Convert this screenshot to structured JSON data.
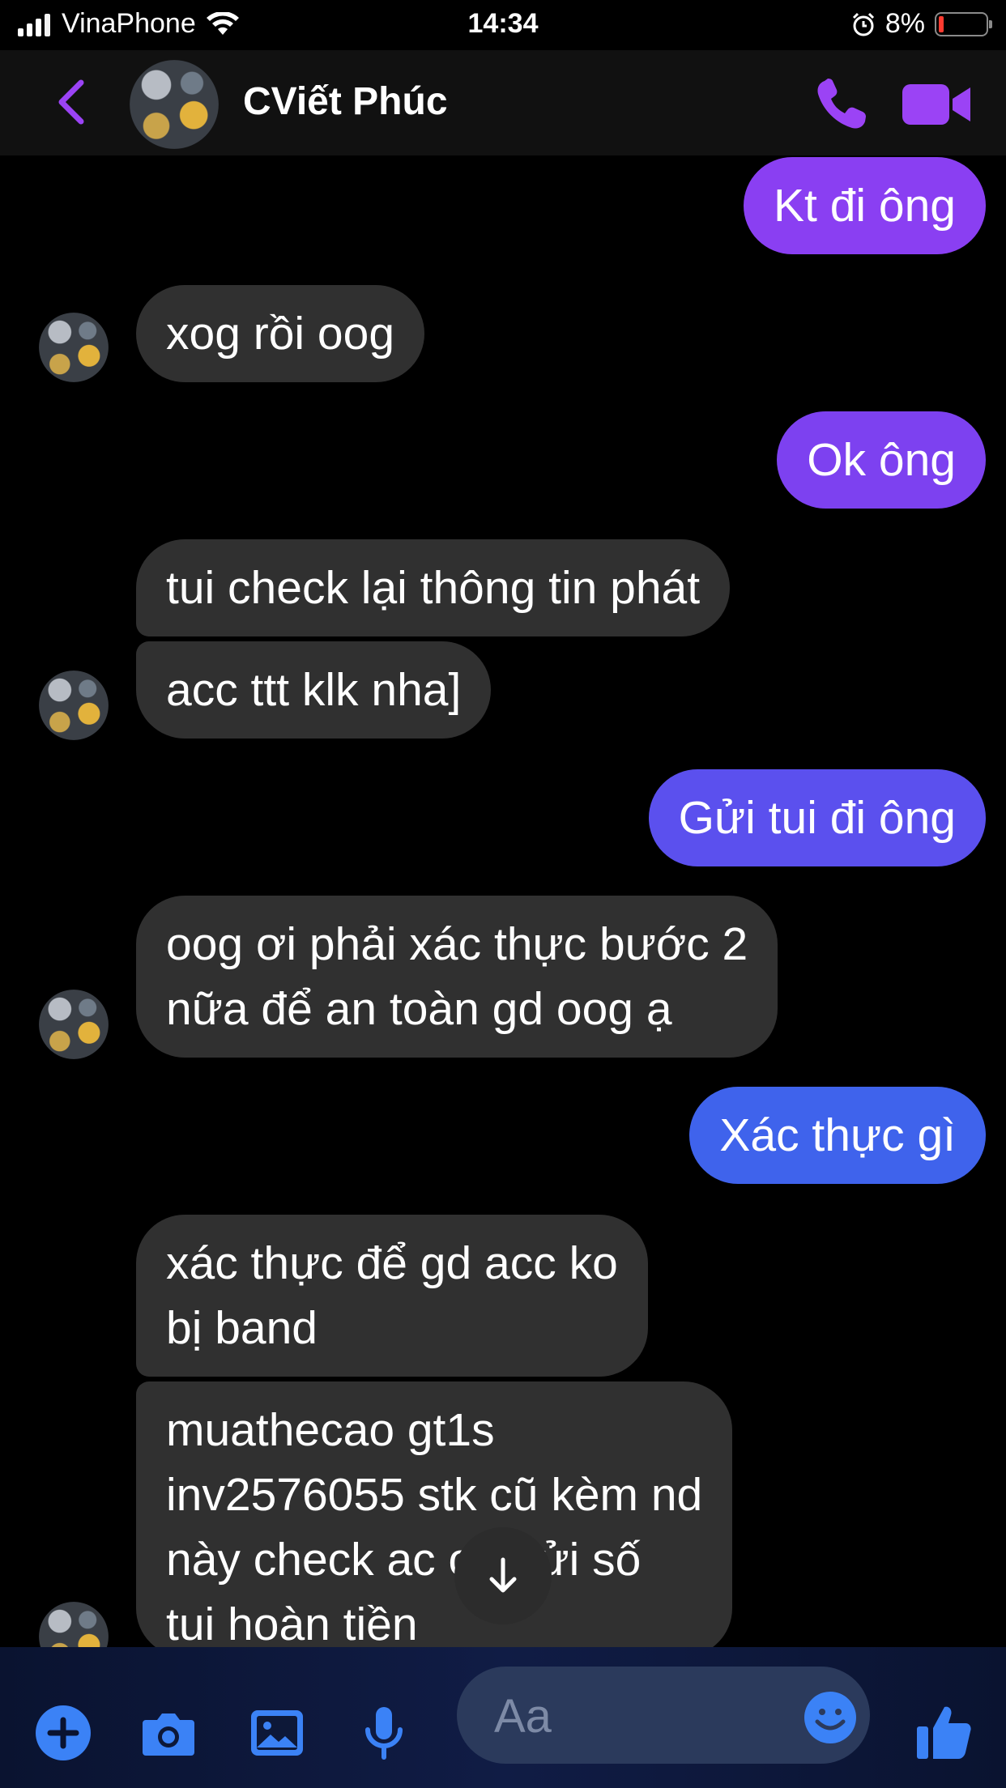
{
  "status_bar": {
    "carrier": "VinaPhone",
    "time": "14:34",
    "battery_percent": "8%"
  },
  "header": {
    "contact_name": "CViết Phúc"
  },
  "messages": [
    {
      "side": "sent",
      "text": "Kt đi ông"
    },
    {
      "side": "received",
      "text": "xog rồi oog"
    },
    {
      "side": "sent",
      "text": "Ok ông"
    },
    {
      "side": "received",
      "text": "tui check lại thông tin phát"
    },
    {
      "side": "received",
      "text": "acc ttt klk nha]"
    },
    {
      "side": "sent",
      "text": "Gửi tui đi ông"
    },
    {
      "side": "received",
      "lines": [
        "oog ơi phải xác thực bước 2",
        "nữa để an toàn gd oog ạ"
      ]
    },
    {
      "side": "sent",
      "text": "Xác thực gì"
    },
    {
      "side": "received",
      "lines": [
        "xác thực để gd acc ko",
        "bị band"
      ]
    },
    {
      "side": "received",
      "lines": [
        "muathecao gt1s",
        "inv2576055 stk cũ kèm nd",
        "này check ac   og gửi số",
        "tui hoàn tiền"
      ]
    }
  ],
  "composer": {
    "placeholder": "Aa",
    "icons": [
      "plus-icon",
      "camera-icon",
      "image-icon",
      "microphone-icon",
      "emoji-icon",
      "thumbs-up-icon"
    ]
  },
  "colors": {
    "background": "#000000",
    "received_bubble": "#303030",
    "sent_gradient_top": "#8a3ff2",
    "sent_gradient_bottom": "#3f63ec",
    "accent_purple": "#9b43f5",
    "composer_blue": "#3b82f6"
  }
}
